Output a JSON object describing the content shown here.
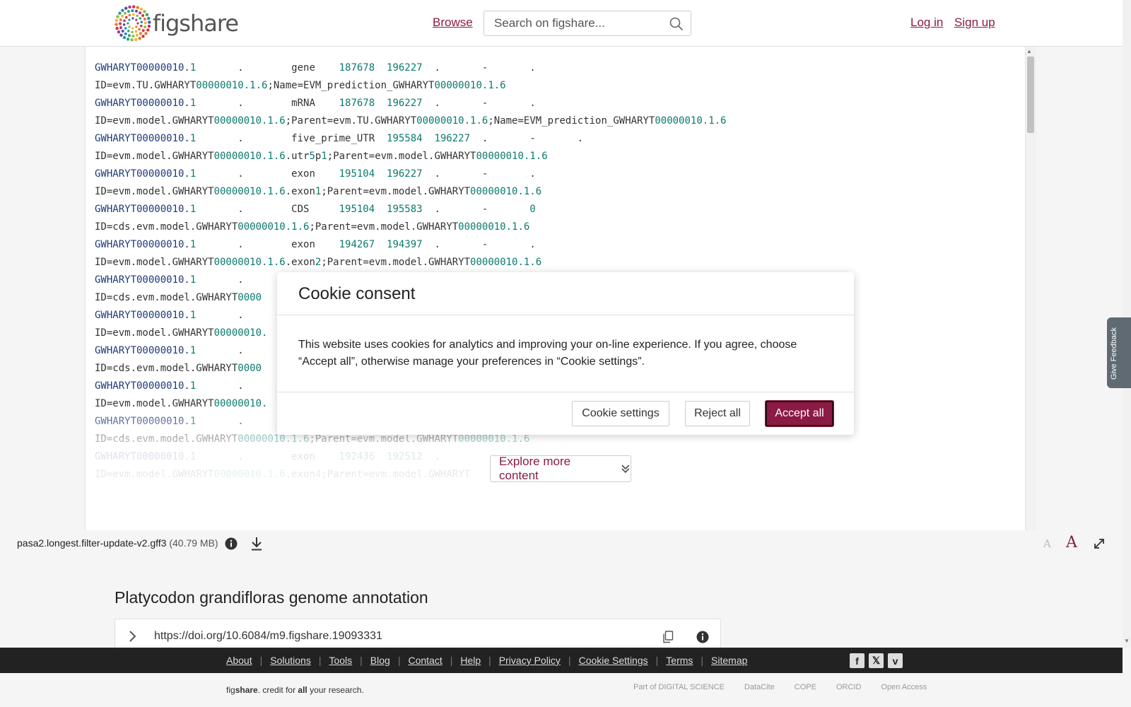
{
  "header": {
    "logo_text": "figshare",
    "browse": "Browse",
    "search_placeholder": "Search on figshare...",
    "login": "Log in",
    "signup": "Sign up"
  },
  "viewer": {
    "lines": [
      [
        [
          "id",
          "GWHARYT00000010."
        ],
        [
          "num",
          "1"
        ],
        [
          "t",
          "       .        gene    "
        ],
        [
          "num",
          "187678  196227"
        ],
        [
          "t",
          "  .       -       ."
        ]
      ],
      [
        [
          "t",
          "ID=evm.TU.GWHARYT"
        ],
        [
          "num",
          "00000010.1.6"
        ],
        [
          "t",
          ";Name=EVM_prediction_GWHARYT"
        ],
        [
          "num",
          "00000010.1.6"
        ]
      ],
      [
        [
          "id",
          "GWHARYT00000010."
        ],
        [
          "num",
          "1"
        ],
        [
          "t",
          "       .        mRNA    "
        ],
        [
          "num",
          "187678  196227"
        ],
        [
          "t",
          "  .       -       ."
        ]
      ],
      [
        [
          "t",
          "ID=evm.model.GWHARYT"
        ],
        [
          "num",
          "00000010.1.6"
        ],
        [
          "t",
          ";Parent=evm.TU.GWHARYT"
        ],
        [
          "num",
          "00000010.1.6"
        ],
        [
          "t",
          ";Name=EVM_prediction_GWHARYT"
        ],
        [
          "num",
          "00000010.1.6"
        ]
      ],
      [
        [
          "id",
          "GWHARYT00000010."
        ],
        [
          "num",
          "1"
        ],
        [
          "t",
          "       .        five_prime_UTR  "
        ],
        [
          "num",
          "195584  196227"
        ],
        [
          "t",
          "  .       -       ."
        ]
      ],
      [
        [
          "t",
          "ID=evm.model.GWHARYT"
        ],
        [
          "num",
          "00000010.1.6"
        ],
        [
          "t",
          ".utr"
        ],
        [
          "num",
          "5"
        ],
        [
          "t",
          "p"
        ],
        [
          "num",
          "1"
        ],
        [
          "t",
          ";Parent=evm.model.GWHARYT"
        ],
        [
          "num",
          "00000010.1.6"
        ]
      ],
      [
        [
          "id",
          "GWHARYT00000010."
        ],
        [
          "num",
          "1"
        ],
        [
          "t",
          "       .        exon    "
        ],
        [
          "num",
          "195104  196227"
        ],
        [
          "t",
          "  .       -       ."
        ]
      ],
      [
        [
          "t",
          "ID=evm.model.GWHARYT"
        ],
        [
          "num",
          "00000010.1.6"
        ],
        [
          "t",
          ".exon"
        ],
        [
          "num",
          "1"
        ],
        [
          "t",
          ";Parent=evm.model.GWHARYT"
        ],
        [
          "num",
          "00000010.1.6"
        ]
      ],
      [
        [
          "id",
          "GWHARYT00000010."
        ],
        [
          "num",
          "1"
        ],
        [
          "t",
          "       .        CDS     "
        ],
        [
          "num",
          "195104  195583"
        ],
        [
          "t",
          "  .       -       "
        ],
        [
          "num",
          "0"
        ]
      ],
      [
        [
          "t",
          "ID=cds.evm.model.GWHARYT"
        ],
        [
          "num",
          "00000010.1.6"
        ],
        [
          "t",
          ";Parent=evm.model.GWHARYT"
        ],
        [
          "num",
          "00000010.1.6"
        ]
      ],
      [
        [
          "id",
          "GWHARYT00000010."
        ],
        [
          "num",
          "1"
        ],
        [
          "t",
          "       .        exon    "
        ],
        [
          "num",
          "194267  194397"
        ],
        [
          "t",
          "  .       -       ."
        ]
      ],
      [
        [
          "t",
          "ID=evm.model.GWHARYT"
        ],
        [
          "num",
          "00000010.1.6"
        ],
        [
          "t",
          ".exon"
        ],
        [
          "num",
          "2"
        ],
        [
          "t",
          ";Parent=evm.model.GWHARYT"
        ],
        [
          "num",
          "00000010.1.6"
        ]
      ],
      [
        [
          "id",
          "GWHARYT00000010."
        ],
        [
          "num",
          "1"
        ],
        [
          "t",
          "       ."
        ]
      ],
      [
        [
          "t",
          "ID=cds.evm.model.GWHARYT"
        ],
        [
          "num",
          "0000"
        ]
      ],
      [
        [
          "id",
          "GWHARYT00000010."
        ],
        [
          "num",
          "1"
        ],
        [
          "t",
          "       ."
        ]
      ],
      [
        [
          "t",
          "ID=evm.model.GWHARYT"
        ],
        [
          "num",
          "00000010."
        ]
      ],
      [
        [
          "id",
          "GWHARYT00000010."
        ],
        [
          "num",
          "1"
        ],
        [
          "t",
          "       ."
        ]
      ],
      [
        [
          "t",
          "ID=cds.evm.model.GWHARYT"
        ],
        [
          "num",
          "0000"
        ]
      ],
      [
        [
          "id",
          "GWHARYT00000010."
        ],
        [
          "num",
          "1"
        ],
        [
          "t",
          "       ."
        ]
      ],
      [
        [
          "t",
          "ID=evm.model.GWHARYT"
        ],
        [
          "num",
          "00000010."
        ]
      ],
      [
        [
          "id",
          "GWHARYT00000010."
        ],
        [
          "num",
          "1"
        ],
        [
          "t",
          "       ."
        ]
      ],
      [
        [
          "t",
          "ID=cds.evm.model.GWHARYT"
        ],
        [
          "num",
          "00000010.1.6"
        ],
        [
          "t",
          ";Parent=evm.model.GWHARYT"
        ],
        [
          "num",
          "00000010.1.6"
        ]
      ],
      [
        [
          "id",
          "GWHARYT00000010."
        ],
        [
          "num",
          "1"
        ],
        [
          "t",
          "       .        exon    "
        ],
        [
          "num",
          "192436  192512"
        ],
        [
          "t",
          "  ."
        ]
      ],
      [
        [
          "t",
          "ID=evm.model.GWHARYT"
        ],
        [
          "num",
          "00000010.1.6"
        ],
        [
          "t",
          ".exon"
        ],
        [
          "num",
          "4"
        ],
        [
          "t",
          ";Parent=evm.model.GWHARYT"
        ]
      ]
    ],
    "explore_label": "Explore more content"
  },
  "file": {
    "name": "pasa2.longest.filter-update-v2.gff3",
    "size": "(40.79 MB)",
    "font_small": "A",
    "font_large": "A"
  },
  "item": {
    "title": "Platycodon grandifloras genome annotation",
    "doi": "https://doi.org/10.6084/m9.figshare.19093331"
  },
  "footer": {
    "links": [
      "About",
      "Solutions",
      "Tools",
      "Blog",
      "Contact",
      "Help",
      "Privacy Policy",
      "Cookie Settings",
      "Terms",
      "Sitemap"
    ],
    "credit_prefix": "fig",
    "credit_brand": "share",
    "credit_mid": ". credit for ",
    "credit_all": "all",
    "credit_suffix": " your research.",
    "partners": [
      "Part of DIGITAL SCIENCE",
      "DataCite",
      "COPE",
      "ORCID",
      "Open Access"
    ]
  },
  "cookie": {
    "title": "Cookie consent",
    "body": "This website uses cookies for analytics and improving your on-line experience. If you agree, choose “Accept all”, otherwise manage your preferences in “Cookie settings”.",
    "settings": "Cookie settings",
    "reject": "Reject all",
    "accept": "Accept all"
  },
  "feedback": "Give Feedback",
  "colors": {
    "brand": "#8b1a45",
    "id_text": "#1f3a78",
    "num_text": "#0b7a6e"
  }
}
